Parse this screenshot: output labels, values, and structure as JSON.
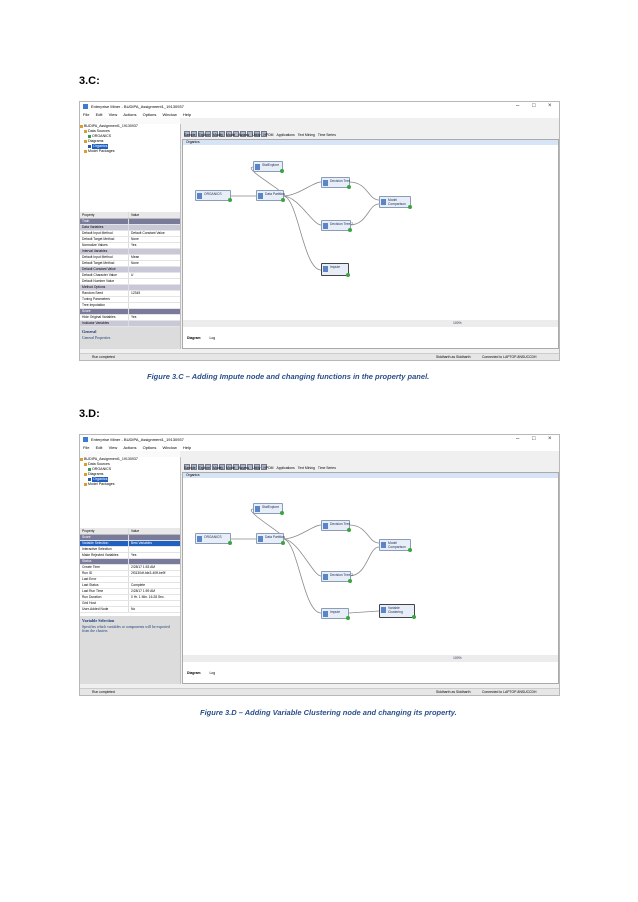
{
  "sections": [
    {
      "heading": "3.C:",
      "caption": "Figure 3.C – Adding Impute node and changing functions in the property panel.",
      "screenshot": {
        "window_title": "Enterprise Miner - BUDIPA_Assignment1_19130937",
        "menu": [
          "File",
          "Edit",
          "View",
          "Actions",
          "Options",
          "Window",
          "Help"
        ],
        "tree": [
          "BUDIPA_Assignment1_19130937",
          "Data Sources",
          "ORGANICS",
          "Diagrams",
          "Organics",
          "Model Packages"
        ],
        "tabs": [
          "Sample",
          "Explore",
          "Modify",
          "Model",
          "Assess",
          "Utility",
          "HPDM",
          "Applications",
          "Text Mining",
          "Time Series"
        ],
        "diagram_title": "Organics",
        "properties_header": [
          "Property",
          "Value"
        ],
        "properties": [
          {
            "k": "Train",
            "v": "",
            "style": "group"
          },
          {
            "k": "Data Variables",
            "v": "",
            "style": "sub"
          },
          {
            "k": "Default Input Method",
            "v": "Default Constant Value",
            "style": ""
          },
          {
            "k": "Default Target Method",
            "v": "None",
            "style": ""
          },
          {
            "k": "Normalize Values",
            "v": "Yes",
            "style": ""
          },
          {
            "k": "Interval Variables",
            "v": "",
            "style": "sub"
          },
          {
            "k": "Default Input Method",
            "v": "Mean",
            "style": ""
          },
          {
            "k": "Default Target Method",
            "v": "None",
            "style": ""
          },
          {
            "k": "Default Constant Value",
            "v": "",
            "style": "sub"
          },
          {
            "k": "Default Character Value",
            "v": "U",
            "style": ""
          },
          {
            "k": "Default Number Value",
            "v": "",
            "style": ""
          },
          {
            "k": "Method Options",
            "v": "",
            "style": "sub"
          },
          {
            "k": "Random Seed",
            "v": "12345",
            "style": ""
          },
          {
            "k": "Tuning Parameters",
            "v": "",
            "style": ""
          },
          {
            "k": "Tree Imputation",
            "v": "",
            "style": ""
          },
          {
            "k": "Score",
            "v": "",
            "style": "group"
          },
          {
            "k": "Hide Original Variables",
            "v": "Yes",
            "style": ""
          },
          {
            "k": "Indicator Variables",
            "v": "",
            "style": "sub"
          },
          {
            "k": "Type",
            "v": "Unique",
            "style": ""
          },
          {
            "k": "Source",
            "v": "Missing Variables",
            "style": ""
          },
          {
            "k": "Role",
            "v": "Input",
            "style": ""
          }
        ],
        "description_title": "General",
        "description_body": "General Properties",
        "nodes": [
          {
            "label": "ORGANICS"
          },
          {
            "label": "Data Partition"
          },
          {
            "label": "StatExplore"
          },
          {
            "label": "Decision Tree"
          },
          {
            "label": "Decision Tree 2"
          },
          {
            "label": "Impute"
          },
          {
            "label": "Model Comparison"
          }
        ],
        "bottom_tabs": [
          "Diagram",
          "Log"
        ],
        "zoom": "100%",
        "status_left": "Run completed",
        "status_user": "Siddharth as Siddharth",
        "status_conn": "Connected to LAPTOP-8NSUCCDH"
      }
    },
    {
      "heading": "3.D:",
      "caption": "Figure 3.D – Adding Variable Clustering node and changing its property.",
      "screenshot": {
        "window_title": "Enterprise Miner - BUDIPA_Assignment1_19130937",
        "menu": [
          "File",
          "Edit",
          "View",
          "Actions",
          "Options",
          "Window",
          "Help"
        ],
        "tree": [
          "BUDIPA_Assignment1_19130937",
          "Data Sources",
          "ORGANICS",
          "Diagrams",
          "Organics",
          "Model Packages"
        ],
        "tabs": [
          "Sample",
          "Explore",
          "Modify",
          "Model",
          "Assess",
          "Utility",
          "HPDM",
          "Applications",
          "Text Mining",
          "Time Series"
        ],
        "diagram_title": "Organics",
        "properties_header": [
          "Property",
          "Value"
        ],
        "properties": [
          {
            "k": "Score",
            "v": "",
            "style": "group"
          },
          {
            "k": "Variable Selection",
            "v": "Best Variables",
            "style": "sel"
          },
          {
            "k": "Interactive Selection",
            "v": "",
            "style": ""
          },
          {
            "k": "Make Rejected Variables",
            "v": "Yes",
            "style": ""
          },
          {
            "k": "Status",
            "v": "",
            "style": "group"
          },
          {
            "k": "Create Time",
            "v": "2/28/17 1:53 AM",
            "style": ""
          },
          {
            "k": "Run ID",
            "v": "2f3130df-fde3-40ff-be9f",
            "style": ""
          },
          {
            "k": "Last Error",
            "v": "",
            "style": ""
          },
          {
            "k": "Last Status",
            "v": "Complete",
            "style": ""
          },
          {
            "k": "Last Run Time",
            "v": "2/28/17 1:59 AM",
            "style": ""
          },
          {
            "k": "Run Duration",
            "v": "0 Hr. 1 Min. 16.28 Sec.",
            "style": ""
          },
          {
            "k": "Grid Host",
            "v": "",
            "style": ""
          },
          {
            "k": "User-Added Node",
            "v": "No",
            "style": ""
          }
        ],
        "description_title": "Variable Selection",
        "description_body": "Specifies which variables or components will be exported from the clusters",
        "nodes": [
          {
            "label": "ORGANICS"
          },
          {
            "label": "Data Partition"
          },
          {
            "label": "StatExplore"
          },
          {
            "label": "Decision Tree"
          },
          {
            "label": "Decision Tree 2"
          },
          {
            "label": "Impute"
          },
          {
            "label": "Model Comparison"
          },
          {
            "label": "Variable Clustering"
          }
        ],
        "bottom_tabs": [
          "Diagram",
          "Log"
        ],
        "zoom": "100%",
        "status_left": "Run completed",
        "status_user": "Siddharth as Siddharth",
        "status_conn": "Connected to LAPTOP-8NSUCCDH"
      }
    }
  ]
}
